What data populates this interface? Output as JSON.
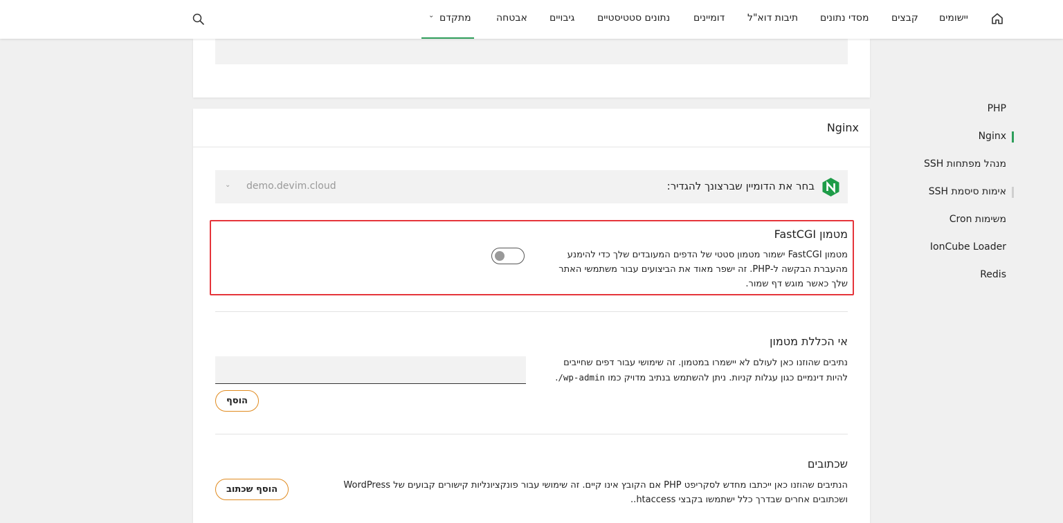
{
  "topnav": {
    "items": [
      "יישומים",
      "קבצים",
      "מסדי נתונים",
      "תיבות דוא\"ל",
      "דומיינים",
      "נתונים סטטיסטיים",
      "גיבויים",
      "אבטחה",
      "מתקדם"
    ],
    "active": "מתקדם"
  },
  "sidenav": {
    "items": [
      "PHP",
      "Nginx",
      "מנהל מפתחות SSH",
      "אימות סיסמת SSH",
      "משימות Cron",
      "IonCube Loader",
      "Redis"
    ],
    "active": "Nginx"
  },
  "card": {
    "title": "Nginx",
    "domain_label": "בחר את הדומיין שברצונך להגדיר:",
    "domain_value": "demo.devim.cloud"
  },
  "fastcgi": {
    "title": "מטמון FastCGI",
    "desc_line1": "מטמון FastCGI ישמור מטמון סטטי של הדפים המעובדים שלך כדי להימנע",
    "desc_line2": "מהעברת הבקשה ל-PHP. זה ישפר מאוד את הביצועים עבור משתמשי האתר",
    "desc_line3": "שלך כאשר מוגש דף שמור.",
    "enabled": false
  },
  "exclusion": {
    "title": "אי הכללת מטמון",
    "desc_line1": "נתיבים שהוזנו כאן לעולם לא יישמרו במטמון. זה שימושי עבור דפים שחייבים",
    "desc_line2": "להיות דינמיים כגון עגלות קניות. ניתן להשתמש בנתיב מדויק כמו",
    "desc_code": "/wp-admin",
    "desc_end": ".",
    "input_value": "",
    "add_label": "הוסף"
  },
  "rewrites": {
    "title": "שכתובים",
    "desc_line1": "הנתיבים שהוזנו כאן ייכתבו מחדש לסקריפט PHP אם הקובץ אינו קיים. זה שימושי עבור פונקציונליות קישורים קבועים של WordPress",
    "desc_line2": "ושכתובים אחרים שבדרך כלל ישתמשו בקבצי htaccess..",
    "add_label": "הוסף שכתוב"
  },
  "colors": {
    "accent_green": "#2e9e5b",
    "highlight_red": "#e5343a",
    "button_orange": "#e08a1e"
  }
}
